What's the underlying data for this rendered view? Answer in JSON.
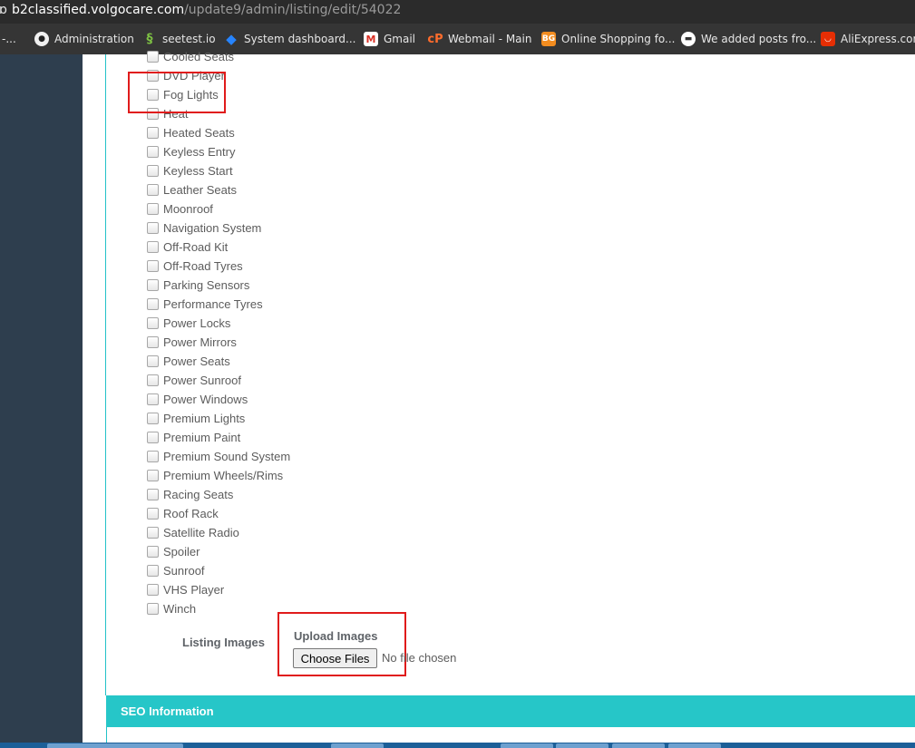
{
  "browser": {
    "url_host": "b2classified.volgocare.com",
    "url_path": "/update9/admin/listing/edit/54022",
    "bookmarks": [
      {
        "label": "-...",
        "icon": "none"
      },
      {
        "label": "Administration",
        "icon": "github-icon"
      },
      {
        "label": "seetest.io",
        "icon": "seetest-icon"
      },
      {
        "label": "System dashboard...",
        "icon": "jira-icon"
      },
      {
        "label": "Gmail",
        "icon": "gmail-icon"
      },
      {
        "label": "Webmail - Main",
        "icon": "cpanel-icon"
      },
      {
        "label": "Online Shopping fo...",
        "icon": "banggood-icon"
      },
      {
        "label": "We added posts fro...",
        "icon": "chat-icon"
      },
      {
        "label": "AliExpress.com",
        "icon": "aliexpress-icon"
      }
    ]
  },
  "features": [
    "Cooled Seats",
    "DVD Player",
    "Fog Lights",
    "Heat",
    "Heated Seats",
    "Keyless Entry",
    "Keyless Start",
    "Leather Seats",
    "Moonroof",
    "Navigation System",
    "Off-Road Kit",
    "Off-Road Tyres",
    "Parking Sensors",
    "Performance Tyres",
    "Power Locks",
    "Power Mirrors",
    "Power Seats",
    "Power Sunroof",
    "Power Windows",
    "Premium Lights",
    "Premium Paint",
    "Premium Sound System",
    "Premium Wheels/Rims",
    "Racing Seats",
    "Roof Rack",
    "Satellite Radio",
    "Spoiler",
    "Sunroof",
    "VHS Player",
    "Winch"
  ],
  "listing_images": {
    "label": "Listing Images",
    "upload_title": "Upload Images",
    "button_label": "Choose Files",
    "status": "No file chosen"
  },
  "seo": {
    "title": "SEO Information"
  },
  "colors": {
    "accent": "#26c6c8",
    "sidebar": "#2e3e4e",
    "highlight": "#e01b1b"
  }
}
